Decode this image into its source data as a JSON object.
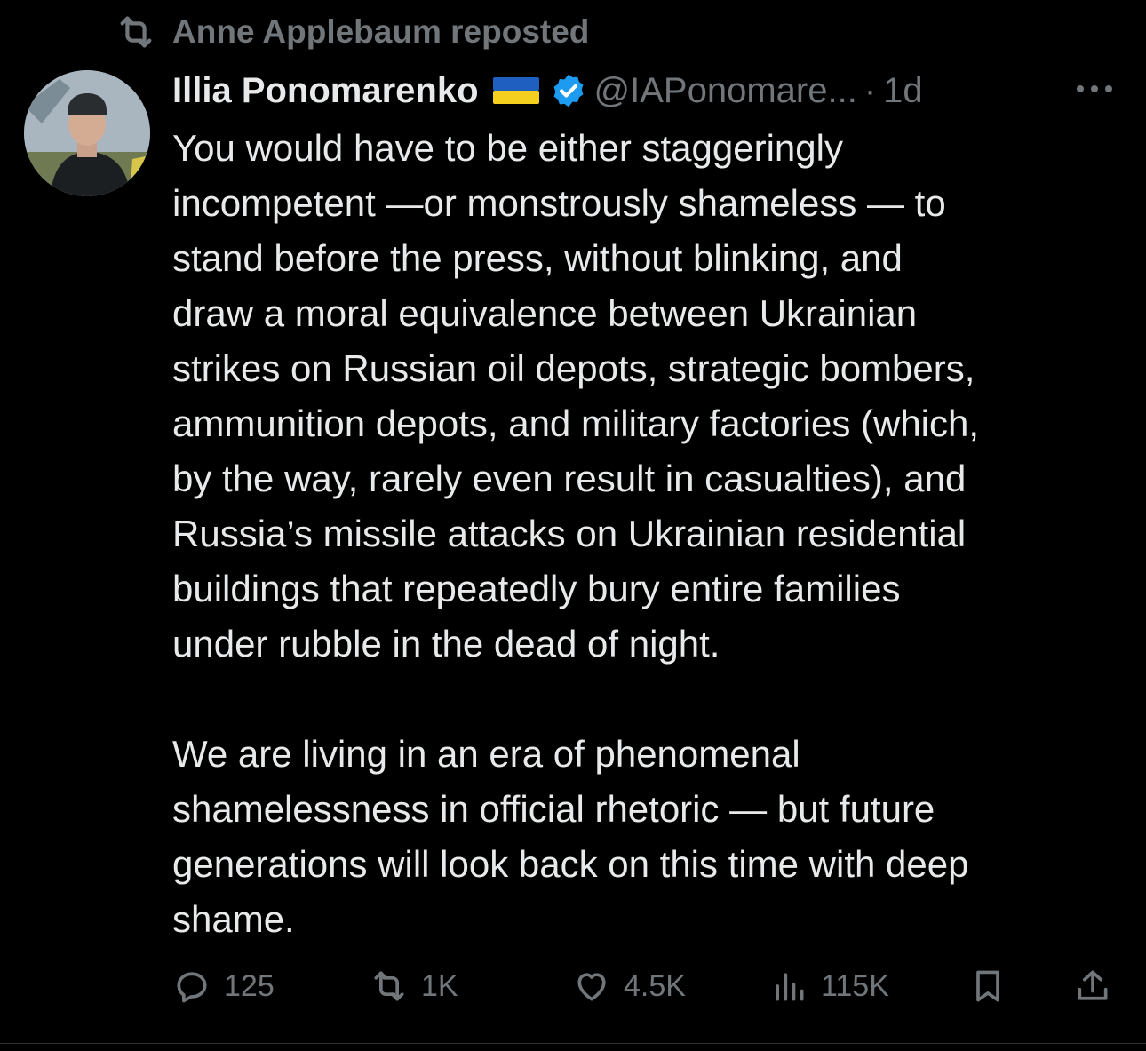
{
  "repost": {
    "label": "Anne Applebaum reposted"
  },
  "tweet": {
    "author_name": "Illia Ponomarenko",
    "handle": "@IAPonomare...",
    "separator": "·",
    "time": "1d",
    "paragraphs": [
      "You would have to be either staggeringly\nincompetent —or monstrously shameless — to\nstand before the press, without blinking, and\ndraw a moral equivalence between Ukrainian\nstrikes on Russian oil depots, strategic bombers,\nammunition depots, and military factories (which,\nby the way, rarely even result in casualties), and\nRussia’s missile attacks on Ukrainian residential\nbuildings that repeatedly bury entire families\nunder rubble in the dead of night.",
      "We are living in an era of phenomenal\nshamelessness in official rhetoric — but future\ngenerations will look back on this time with deep\nshame."
    ]
  },
  "actions": {
    "replies": "125",
    "reposts": "1K",
    "likes": "4.5K",
    "views": "115K"
  },
  "icons": {
    "repost": "repost-icon",
    "verified": "verified-badge-icon",
    "flag": "ukraine-flag-icon",
    "more": "more-icon",
    "reply": "reply-icon",
    "like": "heart-icon",
    "views": "views-icon",
    "bookmark": "bookmark-icon",
    "share": "share-icon"
  },
  "colors": {
    "background": "#000000",
    "text": "#e7e9ea",
    "muted": "#71767b",
    "verified": "#1d9bf0",
    "flag_blue": "#1f5fbf",
    "flag_yellow": "#f5cf1e"
  }
}
